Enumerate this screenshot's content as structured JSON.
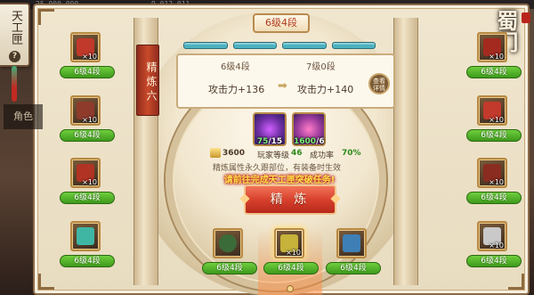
{
  "top_bar": {
    "left_value": "25,000,000",
    "right_value": "9,012,011"
  },
  "logo": {
    "text": "蜀门"
  },
  "side_tab": {
    "title": "天工匣",
    "help_symbol": "?",
    "role_label": "角色"
  },
  "banner": {
    "text": "精炼六"
  },
  "stage": {
    "current_level": "6级4段",
    "progress": {
      "filled": 4,
      "total": 4
    }
  },
  "compare": {
    "from_level": "6级4段",
    "to_level": "7级0段",
    "from_attack": "攻击力+136",
    "to_attack": "攻击力+140",
    "arrow": "➡",
    "detail_button": "查看详情"
  },
  "materials": [
    {
      "name": "purple-gem",
      "have": "75",
      "need": "/15"
    },
    {
      "name": "pink-gem",
      "have": "1600",
      "need": "/6"
    }
  ],
  "info": {
    "coins": "3600",
    "player_level_label": "玩家等级",
    "player_level": "46",
    "success_label": "成功率",
    "success_rate": "70%"
  },
  "description": "精炼属性永久跟部位，有装备时生效",
  "task_hint": "请前往完成天工匣突破任务!",
  "refine_button": "精 炼",
  "slots_left": [
    {
      "level": "6级4段",
      "qty": "×10",
      "color": "#c0392b"
    },
    {
      "level": "6级4段",
      "qty": "×10",
      "color": "#8e3b2c"
    },
    {
      "level": "6级4段",
      "qty": "×10",
      "color": "#b03324"
    },
    {
      "level": "6级4段",
      "qty": "",
      "color": "#3fb6a4"
    }
  ],
  "slots_right": [
    {
      "level": "6级4段",
      "qty": "×10",
      "color": "#a42a1f"
    },
    {
      "level": "6级4段",
      "qty": "×10",
      "color": "#c23a2c"
    },
    {
      "level": "6级4段",
      "qty": "×10",
      "color": "#8a2c20"
    },
    {
      "level": "6级4段",
      "qty": "×10",
      "color": "#c9c9c9"
    }
  ],
  "slots_bottom": [
    {
      "level": "6级4段",
      "qty": "",
      "color": "#3c6b3a"
    },
    {
      "level": "6级4段",
      "qty": "×10",
      "color": "#c7b23a"
    },
    {
      "level": "6级4段",
      "qty": "",
      "color": "#3e7fb6"
    }
  ],
  "colors": {
    "accent_red": "#d8412d",
    "level_green": "#3e9a1c",
    "gold_border": "#b88a45"
  }
}
